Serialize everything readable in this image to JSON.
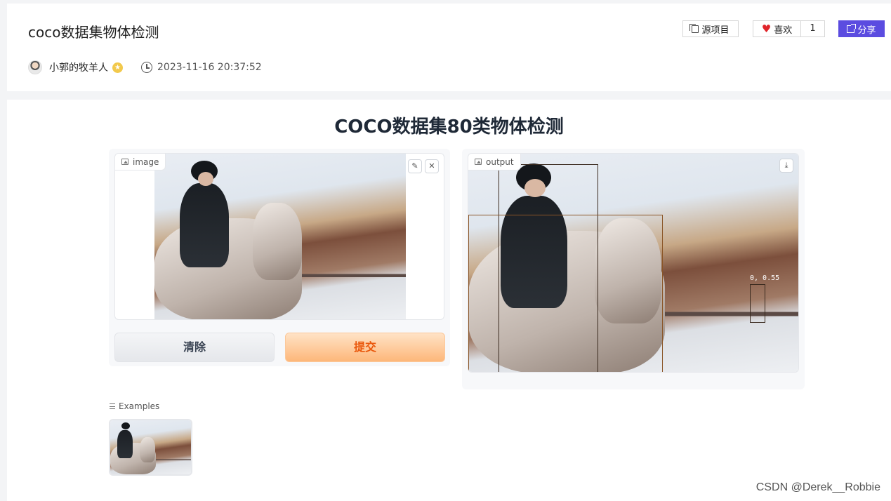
{
  "header": {
    "project_title": "coco数据集物体检测",
    "author": "小郭的牧羊人",
    "timestamp": "2023-11-16 20:37:52",
    "source_button": "源项目",
    "like_button": "喜欢",
    "like_count": "1",
    "share_button": "分享"
  },
  "app": {
    "title": "COCO数据集80类物体检测",
    "input": {
      "label": "image",
      "clear_button": "清除",
      "submit_button": "提交"
    },
    "output": {
      "label": "output",
      "detection_label": "0, 0.55"
    },
    "examples": {
      "label": "Examples"
    }
  },
  "watermark": "CSDN @Derek__Robbie",
  "icons": [
    "copy-icon",
    "heart-icon",
    "share-icon",
    "clock-icon",
    "image-icon",
    "edit-icon",
    "close-icon",
    "download-icon",
    "list-icon"
  ],
  "colors": {
    "submit_text": "#ea580c",
    "share_bg": "#5b4ce0",
    "heart": "#e0252b"
  }
}
